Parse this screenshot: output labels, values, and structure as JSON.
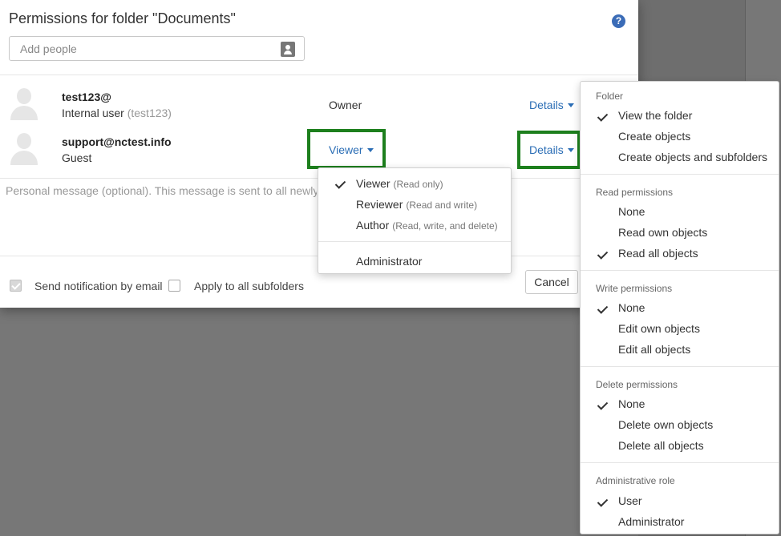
{
  "dialog": {
    "title": "Permissions for folder \"Documents\"",
    "help_icon": "?",
    "add_people_placeholder": "Add people"
  },
  "users": [
    {
      "name": "test123@",
      "type": "Internal user",
      "login": "(test123)",
      "role": "Owner",
      "details_label": "Details"
    },
    {
      "name": "support@nctest.info",
      "type": "Guest",
      "login": "",
      "role": "Viewer",
      "details_label": "Details"
    }
  ],
  "personal_message_placeholder": "Personal message (optional). This message is sent to all newly invited",
  "footer": {
    "send_notification_label": "Send notification by email",
    "send_notification_checked": true,
    "apply_subfolders_label": "Apply to all subfolders",
    "apply_subfolders_checked": false,
    "cancel_label": "Cancel"
  },
  "role_menu": {
    "items": [
      {
        "label": "Viewer",
        "sub": "(Read only)",
        "checked": true
      },
      {
        "label": "Reviewer",
        "sub": "(Read and write)",
        "checked": false
      },
      {
        "label": "Author",
        "sub": "(Read, write, and delete)",
        "checked": false
      }
    ],
    "admin_label": "Administrator"
  },
  "details_menu": {
    "sections": [
      {
        "header": "Folder",
        "items": [
          {
            "label": "View the folder",
            "checked": true
          },
          {
            "label": "Create objects",
            "checked": false
          },
          {
            "label": "Create objects and subfolders",
            "checked": false
          }
        ]
      },
      {
        "header": "Read permissions",
        "items": [
          {
            "label": "None",
            "checked": false
          },
          {
            "label": "Read own objects",
            "checked": false
          },
          {
            "label": "Read all objects",
            "checked": true
          }
        ]
      },
      {
        "header": "Write permissions",
        "items": [
          {
            "label": "None",
            "checked": true
          },
          {
            "label": "Edit own objects",
            "checked": false
          },
          {
            "label": "Edit all objects",
            "checked": false
          }
        ]
      },
      {
        "header": "Delete permissions",
        "items": [
          {
            "label": "None",
            "checked": true
          },
          {
            "label": "Delete own objects",
            "checked": false
          },
          {
            "label": "Delete all objects",
            "checked": false
          }
        ]
      },
      {
        "header": "Administrative role",
        "items": [
          {
            "label": "User",
            "checked": true
          },
          {
            "label": "Administrator",
            "checked": false
          }
        ]
      }
    ]
  },
  "colors": {
    "link": "#2a6db5",
    "highlight": "#1d7f1d",
    "backdrop": "#777777"
  }
}
